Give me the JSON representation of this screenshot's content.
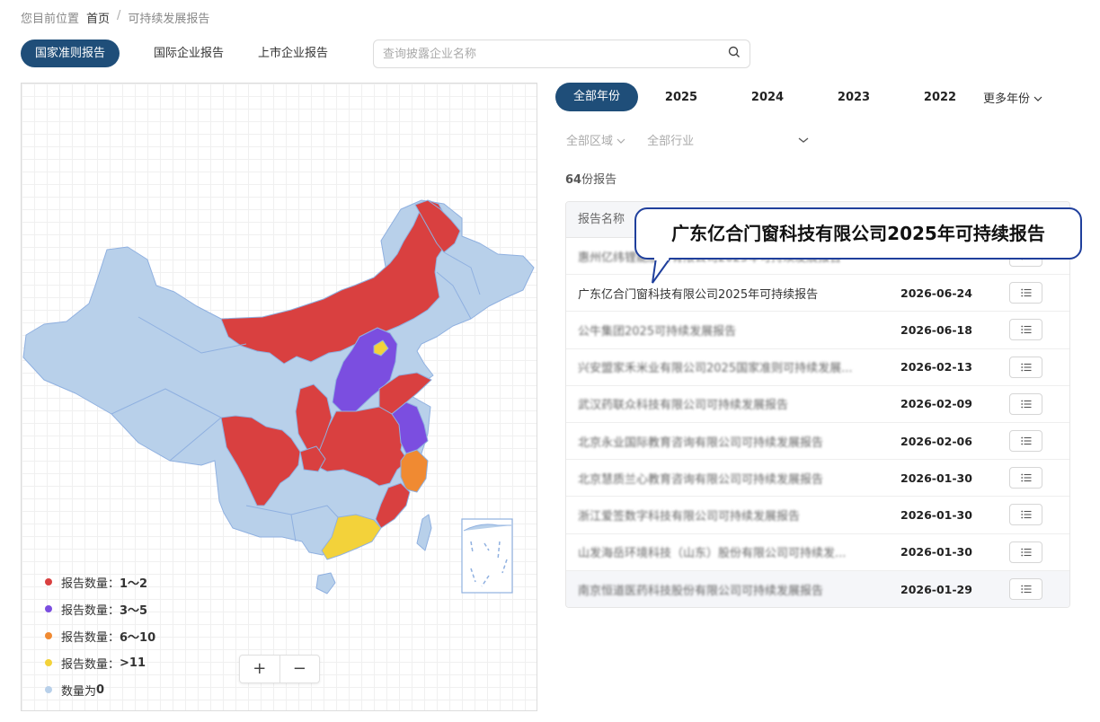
{
  "breadcrumb": {
    "prefix": "您目前位置",
    "home": "首页",
    "sep": "/",
    "current": "可持续发展报告"
  },
  "tabs": {
    "active": "国家准则报告",
    "intl": "国际企业报告",
    "listed": "上市企业报告"
  },
  "search": {
    "placeholder": "查询披露企业名称"
  },
  "years": {
    "all": "全部年份",
    "y1": "2025",
    "y2": "2024",
    "y3": "2023",
    "y4": "2022",
    "more": "更多年份"
  },
  "filters": {
    "region": "全部区域",
    "industry": "全部行业"
  },
  "count": {
    "num": "64",
    "suffix": "份报告"
  },
  "table": {
    "header": "报告名称",
    "rows": [
      {
        "name": "惠州亿纬锂能股份有限公司2025年可持续发展报告",
        "date": "",
        "blur": true
      },
      {
        "name": "广东亿合门窗科技有限公司2025年可持续报告",
        "date": "2026-06-24",
        "blur": false
      },
      {
        "name": "公牛集团2025可持续发展报告",
        "date": "2026-06-18",
        "blur": true
      },
      {
        "name": "兴安盟家禾米业有限公司2025国家准则可持续发展...",
        "date": "2026-02-13",
        "blur": true
      },
      {
        "name": "武汉药联众科技有限公司可持续发展报告",
        "date": "2026-02-09",
        "blur": true
      },
      {
        "name": "北京永业国际教育咨询有限公司可持续发展报告",
        "date": "2026-02-06",
        "blur": true
      },
      {
        "name": "北京慧质兰心教育咨询有限公司可持续发展报告",
        "date": "2026-01-30",
        "blur": true
      },
      {
        "name": "浙江爱签数字科技有限公司可持续发展报告",
        "date": "2026-01-30",
        "blur": true
      },
      {
        "name": "山发海岳环境科技（山东）股份有限公司可持续发...",
        "date": "2026-01-30",
        "blur": true
      },
      {
        "name": "南京恒道医药科技股份有限公司可持续发展报告",
        "date": "2026-01-29",
        "blur": true
      }
    ]
  },
  "tooltip": {
    "text": "广东亿合门窗科技有限公司2025年可持续报告"
  },
  "legend": {
    "l1": {
      "label": "报告数量：",
      "range": "1～2",
      "color": "#d94040"
    },
    "l2": {
      "label": "报告数量：",
      "range": "3～5",
      "color": "#7b4ee0"
    },
    "l3": {
      "label": "报告数量：",
      "range": "6～10",
      "color": "#f08a32"
    },
    "l4": {
      "label": "报告数量：",
      "range": ">11",
      "color": "#f3d23a"
    },
    "l5": {
      "label": "数量为",
      "range": "0",
      "color": "#b8d0ea"
    }
  },
  "zoom": {
    "plus": "+",
    "minus": "−"
  },
  "colors": {
    "accent": "#1f4e79",
    "red": "#d94040",
    "purple": "#7b4ee0",
    "orange": "#f08a32",
    "yellow": "#f3d23a",
    "blue": "#b8d0ea"
  }
}
